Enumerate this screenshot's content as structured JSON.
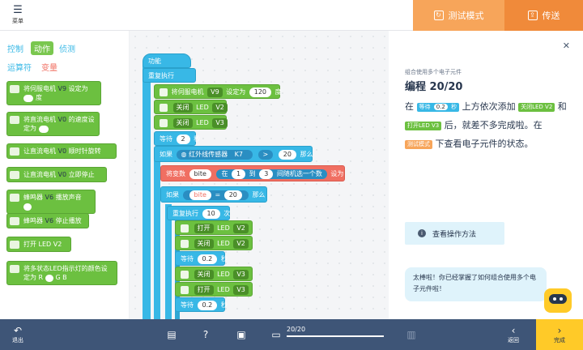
{
  "header": {
    "menu_label": "菜单",
    "test_mode_label": "测试模式",
    "upload_label": "传送",
    "colors": {
      "test_mode": "#f7a55a",
      "upload": "#f08a3a"
    }
  },
  "palette": {
    "categories": [
      "控制",
      "动作",
      "侦测",
      "运算符",
      "变量"
    ],
    "active_category": "动作",
    "blocks": [
      {
        "pre": "将伺服电机",
        "dd": "V9",
        "post": "设定为",
        "val": "",
        "post2": "度"
      },
      {
        "pre": "将直流电机",
        "dd": "V0",
        "post": "的速度设定为",
        "val": "",
        "post2": ""
      },
      {
        "pre": "让直流电机",
        "dd": "V0",
        "post": "顺时针旋转",
        "val": "",
        "post2": ""
      },
      {
        "pre": "让直流电机",
        "dd": "V0",
        "post": "立即停止",
        "val": "",
        "post2": ""
      },
      {
        "pre": "蜂鸣器",
        "dd": "V6",
        "post": "播放声音",
        "val": "",
        "post2": ""
      },
      {
        "pre": "蜂鸣器",
        "dd": "V6",
        "post": "停止播放",
        "val": "",
        "post2": ""
      },
      {
        "pre": "打开",
        "dd": "LED",
        "post": "V2",
        "val": "",
        "post2": ""
      },
      {
        "pre": "将多状态LED指示灯的颜色设定为",
        "dd": "",
        "post": "R",
        "val": "",
        "post2": "G B"
      }
    ]
  },
  "workspace": {
    "hat_label": "功能",
    "repeat_forever": "重复执行",
    "servo": {
      "pre": "将伺服电机",
      "port": "V9",
      "mid": "设定为",
      "value": "120",
      "unit": "度"
    },
    "led_off_v2": {
      "action": "关闭",
      "kind": "LED",
      "port": "V2"
    },
    "led_off_v3": {
      "action": "关闭",
      "kind": "LED",
      "port": "V3"
    },
    "wait_2": {
      "label": "等待",
      "value": "2",
      "unit": "秒"
    },
    "if_sensor": {
      "if": "如果",
      "sensor": "红外线传感器",
      "port": "K7",
      "op": ">",
      "value": "20",
      "then": "那么"
    },
    "set_var": {
      "pre": "将变数",
      "var": "bite",
      "mid": "在",
      "from": "1",
      "to_label": "到",
      "to": "3",
      "post": "间随机选一个数",
      "end": "设为"
    },
    "if_bite": {
      "if": "如果",
      "var": "bite",
      "op": "=",
      "value": "20",
      "then": "那么"
    },
    "repeat_10": {
      "label": "重复执行",
      "value": "10",
      "unit": "次"
    },
    "inner": [
      {
        "type": "led",
        "action": "打开",
        "kind": "LED",
        "port": "V2"
      },
      {
        "type": "led",
        "action": "关闭",
        "kind": "LED",
        "port": "V2"
      },
      {
        "type": "wait",
        "label": "等待",
        "value": "0.2",
        "unit": "秒"
      },
      {
        "type": "led",
        "action": "关闭",
        "kind": "LED",
        "port": "V3"
      },
      {
        "type": "led",
        "action": "打开",
        "kind": "LED",
        "port": "V3"
      },
      {
        "type": "wait",
        "label": "等待",
        "value": "0.2",
        "unit": "秒"
      }
    ]
  },
  "panel": {
    "subtitle": "组合使用多个电子元件",
    "title": "编程 20/20",
    "instr": {
      "p1": "在",
      "tag_wait": "等待",
      "tag_wait_val": "0.2",
      "tag_wait_unit": "秒",
      "p2": "上方依次添加",
      "tag_off": "关闭LED V2",
      "p3": "和",
      "tag_on": "打开LED V3",
      "p4": "后，就差不多完成啦。在",
      "tag_test": "测试模式",
      "p5": "下查看电子元件的状态。"
    },
    "view_button": "查看操作方法",
    "bubble": "太棒啦！你已经掌握了如何组合使用多个电子元件啦！"
  },
  "footer": {
    "exit_label": "退出",
    "progress_text": "20/20",
    "progress": 1.0,
    "prev_label": "返回",
    "done_label": "完成"
  }
}
